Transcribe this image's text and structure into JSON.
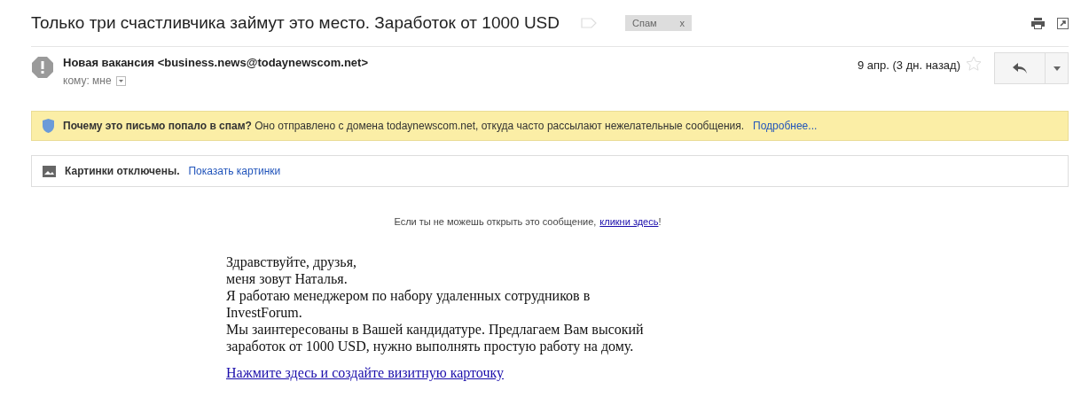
{
  "subject": "Только три счастливчика займут это место. Заработок от 1000 USD",
  "label": {
    "text": "Спам",
    "remove": "x"
  },
  "message": {
    "sender": "Новая вакансия <business.news@todaynewscom.net>",
    "recipient": "кому: мне",
    "date": "9 апр. (3 дн. назад)",
    "starred": false
  },
  "spam_banner": {
    "title": "Почему это письмо попало в спам?",
    "text": "Оно отправлено с домена todaynewscom.net, откуда часто рассылают нежелательные сообщения.",
    "link": "Подробнее..."
  },
  "images_banner": {
    "title": "Картинки отключены.",
    "link": "Показать картинки"
  },
  "body": {
    "notice": "Если ты не можешь открыть это сообщение,",
    "notice_link": "кликни здесь",
    "notice_end": "!",
    "lines": [
      "Здравствуйте, друзья,",
      "меня зовут Наталья.",
      "Я работаю менеджером по набору удаленных сотрудников в",
      "InvestForum.",
      "Мы заинтересованы в Вашей кандидатуре. Предлагаем Вам высокий",
      "заработок от 1000 USD, нужно выполнять простую работу на дому."
    ],
    "link": "Нажмите здесь и создайте визитную карточку"
  }
}
